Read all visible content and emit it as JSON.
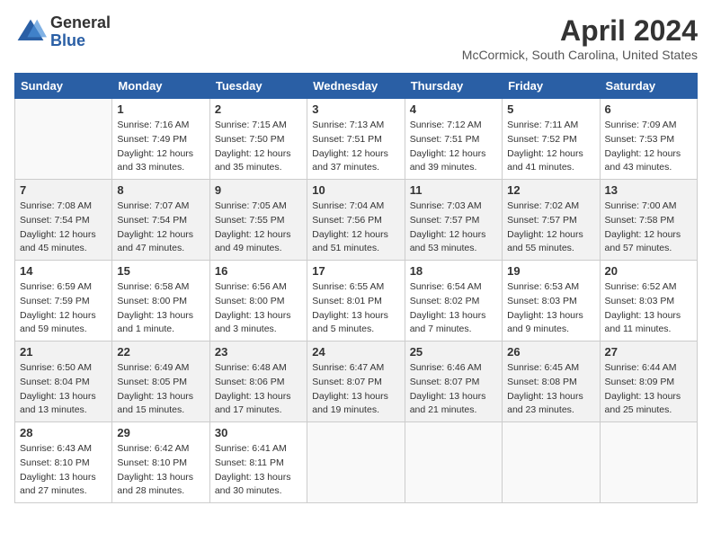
{
  "logo": {
    "general": "General",
    "blue": "Blue"
  },
  "title": "April 2024",
  "location": "McCormick, South Carolina, United States",
  "days_of_week": [
    "Sunday",
    "Monday",
    "Tuesday",
    "Wednesday",
    "Thursday",
    "Friday",
    "Saturday"
  ],
  "weeks": [
    [
      {
        "day": "",
        "info": ""
      },
      {
        "day": "1",
        "info": "Sunrise: 7:16 AM\nSunset: 7:49 PM\nDaylight: 12 hours\nand 33 minutes."
      },
      {
        "day": "2",
        "info": "Sunrise: 7:15 AM\nSunset: 7:50 PM\nDaylight: 12 hours\nand 35 minutes."
      },
      {
        "day": "3",
        "info": "Sunrise: 7:13 AM\nSunset: 7:51 PM\nDaylight: 12 hours\nand 37 minutes."
      },
      {
        "day": "4",
        "info": "Sunrise: 7:12 AM\nSunset: 7:51 PM\nDaylight: 12 hours\nand 39 minutes."
      },
      {
        "day": "5",
        "info": "Sunrise: 7:11 AM\nSunset: 7:52 PM\nDaylight: 12 hours\nand 41 minutes."
      },
      {
        "day": "6",
        "info": "Sunrise: 7:09 AM\nSunset: 7:53 PM\nDaylight: 12 hours\nand 43 minutes."
      }
    ],
    [
      {
        "day": "7",
        "info": "Sunrise: 7:08 AM\nSunset: 7:54 PM\nDaylight: 12 hours\nand 45 minutes."
      },
      {
        "day": "8",
        "info": "Sunrise: 7:07 AM\nSunset: 7:54 PM\nDaylight: 12 hours\nand 47 minutes."
      },
      {
        "day": "9",
        "info": "Sunrise: 7:05 AM\nSunset: 7:55 PM\nDaylight: 12 hours\nand 49 minutes."
      },
      {
        "day": "10",
        "info": "Sunrise: 7:04 AM\nSunset: 7:56 PM\nDaylight: 12 hours\nand 51 minutes."
      },
      {
        "day": "11",
        "info": "Sunrise: 7:03 AM\nSunset: 7:57 PM\nDaylight: 12 hours\nand 53 minutes."
      },
      {
        "day": "12",
        "info": "Sunrise: 7:02 AM\nSunset: 7:57 PM\nDaylight: 12 hours\nand 55 minutes."
      },
      {
        "day": "13",
        "info": "Sunrise: 7:00 AM\nSunset: 7:58 PM\nDaylight: 12 hours\nand 57 minutes."
      }
    ],
    [
      {
        "day": "14",
        "info": "Sunrise: 6:59 AM\nSunset: 7:59 PM\nDaylight: 12 hours\nand 59 minutes."
      },
      {
        "day": "15",
        "info": "Sunrise: 6:58 AM\nSunset: 8:00 PM\nDaylight: 13 hours\nand 1 minute."
      },
      {
        "day": "16",
        "info": "Sunrise: 6:56 AM\nSunset: 8:00 PM\nDaylight: 13 hours\nand 3 minutes."
      },
      {
        "day": "17",
        "info": "Sunrise: 6:55 AM\nSunset: 8:01 PM\nDaylight: 13 hours\nand 5 minutes."
      },
      {
        "day": "18",
        "info": "Sunrise: 6:54 AM\nSunset: 8:02 PM\nDaylight: 13 hours\nand 7 minutes."
      },
      {
        "day": "19",
        "info": "Sunrise: 6:53 AM\nSunset: 8:03 PM\nDaylight: 13 hours\nand 9 minutes."
      },
      {
        "day": "20",
        "info": "Sunrise: 6:52 AM\nSunset: 8:03 PM\nDaylight: 13 hours\nand 11 minutes."
      }
    ],
    [
      {
        "day": "21",
        "info": "Sunrise: 6:50 AM\nSunset: 8:04 PM\nDaylight: 13 hours\nand 13 minutes."
      },
      {
        "day": "22",
        "info": "Sunrise: 6:49 AM\nSunset: 8:05 PM\nDaylight: 13 hours\nand 15 minutes."
      },
      {
        "day": "23",
        "info": "Sunrise: 6:48 AM\nSunset: 8:06 PM\nDaylight: 13 hours\nand 17 minutes."
      },
      {
        "day": "24",
        "info": "Sunrise: 6:47 AM\nSunset: 8:07 PM\nDaylight: 13 hours\nand 19 minutes."
      },
      {
        "day": "25",
        "info": "Sunrise: 6:46 AM\nSunset: 8:07 PM\nDaylight: 13 hours\nand 21 minutes."
      },
      {
        "day": "26",
        "info": "Sunrise: 6:45 AM\nSunset: 8:08 PM\nDaylight: 13 hours\nand 23 minutes."
      },
      {
        "day": "27",
        "info": "Sunrise: 6:44 AM\nSunset: 8:09 PM\nDaylight: 13 hours\nand 25 minutes."
      }
    ],
    [
      {
        "day": "28",
        "info": "Sunrise: 6:43 AM\nSunset: 8:10 PM\nDaylight: 13 hours\nand 27 minutes."
      },
      {
        "day": "29",
        "info": "Sunrise: 6:42 AM\nSunset: 8:10 PM\nDaylight: 13 hours\nand 28 minutes."
      },
      {
        "day": "30",
        "info": "Sunrise: 6:41 AM\nSunset: 8:11 PM\nDaylight: 13 hours\nand 30 minutes."
      },
      {
        "day": "",
        "info": ""
      },
      {
        "day": "",
        "info": ""
      },
      {
        "day": "",
        "info": ""
      },
      {
        "day": "",
        "info": ""
      }
    ]
  ]
}
